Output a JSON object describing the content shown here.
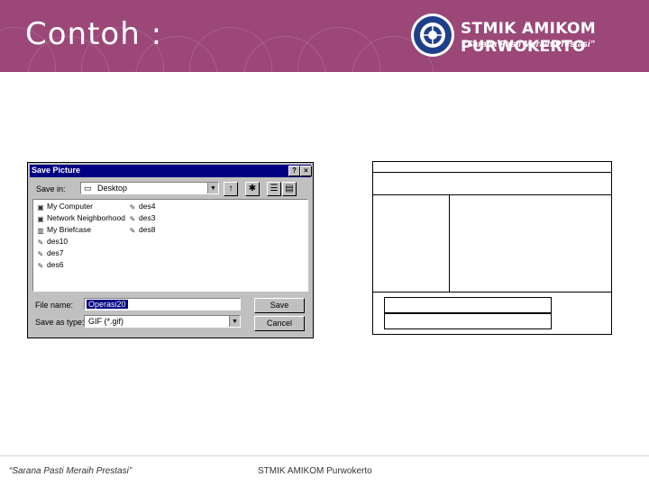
{
  "slide": {
    "title": "Contoh :",
    "brand_name": "STMIK AMIKOM PURWOKERTO",
    "brand_slogan": "“Sarana Pasti Meraih Prestasi”",
    "footer_left": "“Sarana Pasti Meraih Prestasi”",
    "footer_center": "STMIK AMIKOM Purwokerto",
    "colors": {
      "header_bg": "#9b4778",
      "dialog_title_bg": "#000080",
      "dialog_bg": "#c0c0c0"
    }
  },
  "dialog": {
    "title": "Save Picture",
    "help_glyph": "?",
    "close_glyph": "×",
    "save_in_label": "Save in:",
    "save_in_value": "Desktop",
    "files": [
      {
        "label": "My Computer",
        "icon": "computer-icon"
      },
      {
        "label": "Network Neighborhood",
        "icon": "network-icon"
      },
      {
        "label": "My Briefcase",
        "icon": "briefcase-icon"
      },
      {
        "label": "des10",
        "icon": "image-file-icon"
      },
      {
        "label": "des7",
        "icon": "image-file-icon"
      },
      {
        "label": "des6",
        "icon": "image-file-icon"
      },
      {
        "label": "des4",
        "icon": "image-file-icon"
      },
      {
        "label": "des3",
        "icon": "image-file-icon"
      },
      {
        "label": "des8",
        "icon": "image-file-icon"
      }
    ],
    "file_name_label": "File name:",
    "file_name_value": "Operasi20",
    "save_as_label": "Save as type:",
    "save_as_value": "GIF (*.gif)",
    "save_button": "Save",
    "cancel_button": "Cancel"
  }
}
